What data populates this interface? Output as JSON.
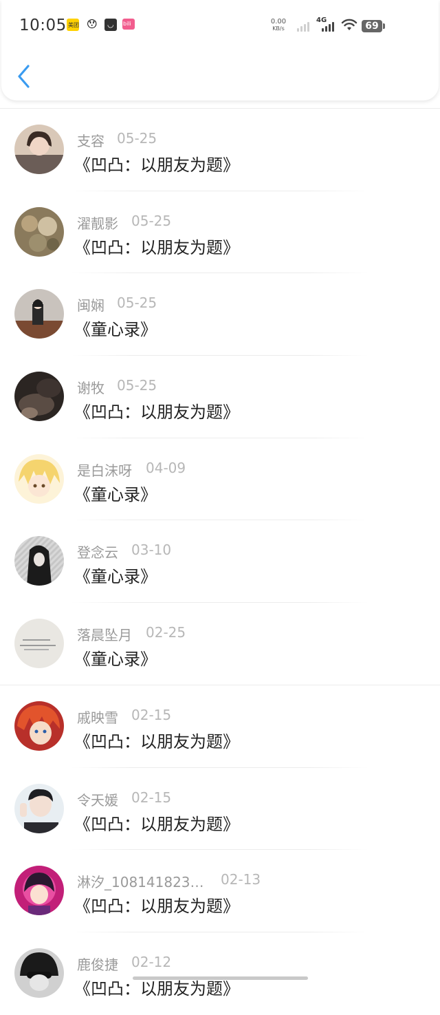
{
  "status_bar": {
    "time": "10:05",
    "net_speed_value": "0.00",
    "net_speed_unit": "KB/s",
    "network_type": "4G",
    "battery": "69",
    "app_icons": [
      "meituan-icon",
      "emoji-face-icon",
      "shopping-bag-icon",
      "bilibili-icon"
    ]
  },
  "header": {
    "back_icon": "chevron-left-icon",
    "accent_color": "#3a9bf0"
  },
  "list": [
    {
      "name": "支容",
      "date": "05-25",
      "title": "《凹凸：以朋友为题》"
    },
    {
      "name": "濯靓影",
      "date": "05-25",
      "title": "《凹凸：以朋友为题》"
    },
    {
      "name": "闽娴",
      "date": "05-25",
      "title": "《童心录》"
    },
    {
      "name": "谢牧",
      "date": "05-25",
      "title": "《凹凸：以朋友为题》"
    },
    {
      "name": "是白沫呀",
      "date": "04-09",
      "title": "《童心录》"
    },
    {
      "name": "登念云",
      "date": "03-10",
      "title": "《童心录》"
    },
    {
      "name": "落晨坠月",
      "date": "02-25",
      "title": "《童心录》"
    },
    {
      "name": "戚映雪",
      "date": "02-15",
      "title": "《凹凸：以朋友为题》"
    },
    {
      "name": "令天媛",
      "date": "02-15",
      "title": "《凹凸：以朋友为题》"
    },
    {
      "name": "淋汐_108141823…",
      "date": "02-13",
      "title": "《凹凸：以朋友为题》"
    },
    {
      "name": "鹿俊捷",
      "date": "02-12",
      "title": "《凹凸：以朋友为题》"
    }
  ]
}
